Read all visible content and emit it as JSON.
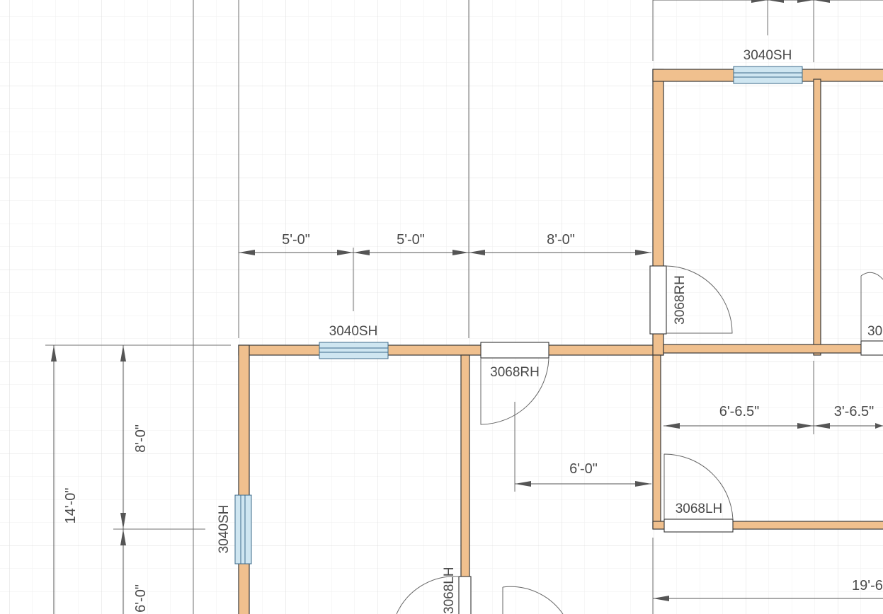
{
  "colors": {
    "wall_fill": "#f0c08e",
    "wall_stroke": "#3a3a3a",
    "window_fill": "#cfe6f1",
    "grid_minor": "#eeeeee",
    "grid_major": "#dcdcdc",
    "background": "#ffffff"
  },
  "dimensions": {
    "top_1": "5'-0\"",
    "top_2": "5'-0\"",
    "top_3": "8'-0\"",
    "left_total": "14'-0\"",
    "left_upper": "8'-0\"",
    "left_lower": "6'-0\"",
    "hall_width": "6'-0\"",
    "right_1": "6'-6.5\"",
    "right_2": "3'-6.5\"",
    "bottom_right": "19'-6"
  },
  "windows": {
    "top_room_window": "3040SH",
    "front_window": "3040SH",
    "left_window": "3040SH"
  },
  "doors": {
    "door_vertical_upper": "3068RH",
    "door_front": "3068RH",
    "door_lower_right": "3068LH",
    "door_bottom_left": "3068LH",
    "door_far_right": "30"
  }
}
